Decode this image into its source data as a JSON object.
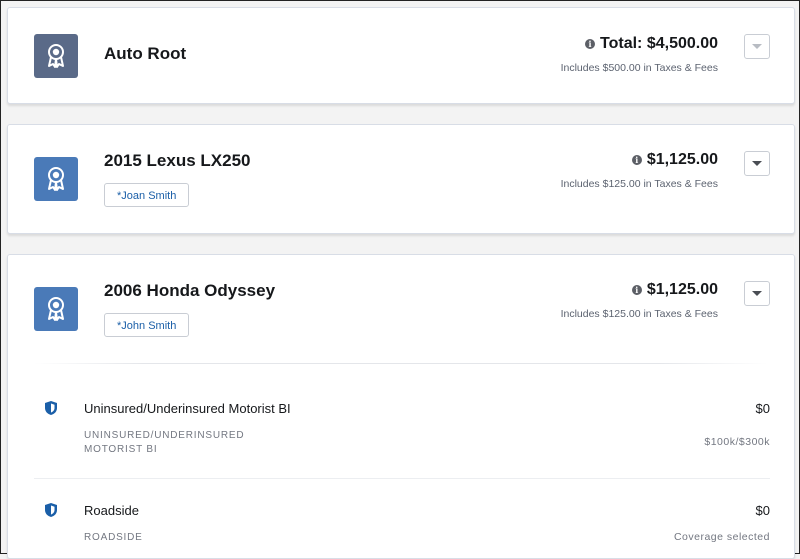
{
  "policies": [
    {
      "title": "Auto Root",
      "price": "Total: $4,500.00",
      "taxes": "Includes $500.00 in Taxes & Fees"
    },
    {
      "title": "2015 Lexus LX250",
      "driver": "*Joan Smith",
      "price": "$1,125.00",
      "taxes": "Includes $125.00 in Taxes & Fees"
    },
    {
      "title": "2006 Honda Odyssey",
      "driver": "*John Smith",
      "price": "$1,125.00",
      "taxes": "Includes $125.00 in Taxes & Fees",
      "coverages": [
        {
          "name": "Uninsured/Underinsured Motorist BI",
          "amount": "$0",
          "sub_line1": "UNINSURED/UNDERINSURED",
          "sub_line2": "MOTORIST BI",
          "detail": "$100k/$300k",
          "icon": "shield-icon"
        },
        {
          "name": "Roadside",
          "amount": "$0",
          "sub_line1": "ROADSIDE",
          "detail": "Coverage selected",
          "icon": "shield-icon"
        }
      ]
    }
  ],
  "icons": {
    "avatar": "award-ribbon-icon",
    "info": "info-icon",
    "menu": "chevron-down-icon"
  },
  "colors": {
    "root_avatar": "#5a6a88",
    "vehicle_avatar": "#4a7ab8",
    "link": "#1b5fa8"
  }
}
